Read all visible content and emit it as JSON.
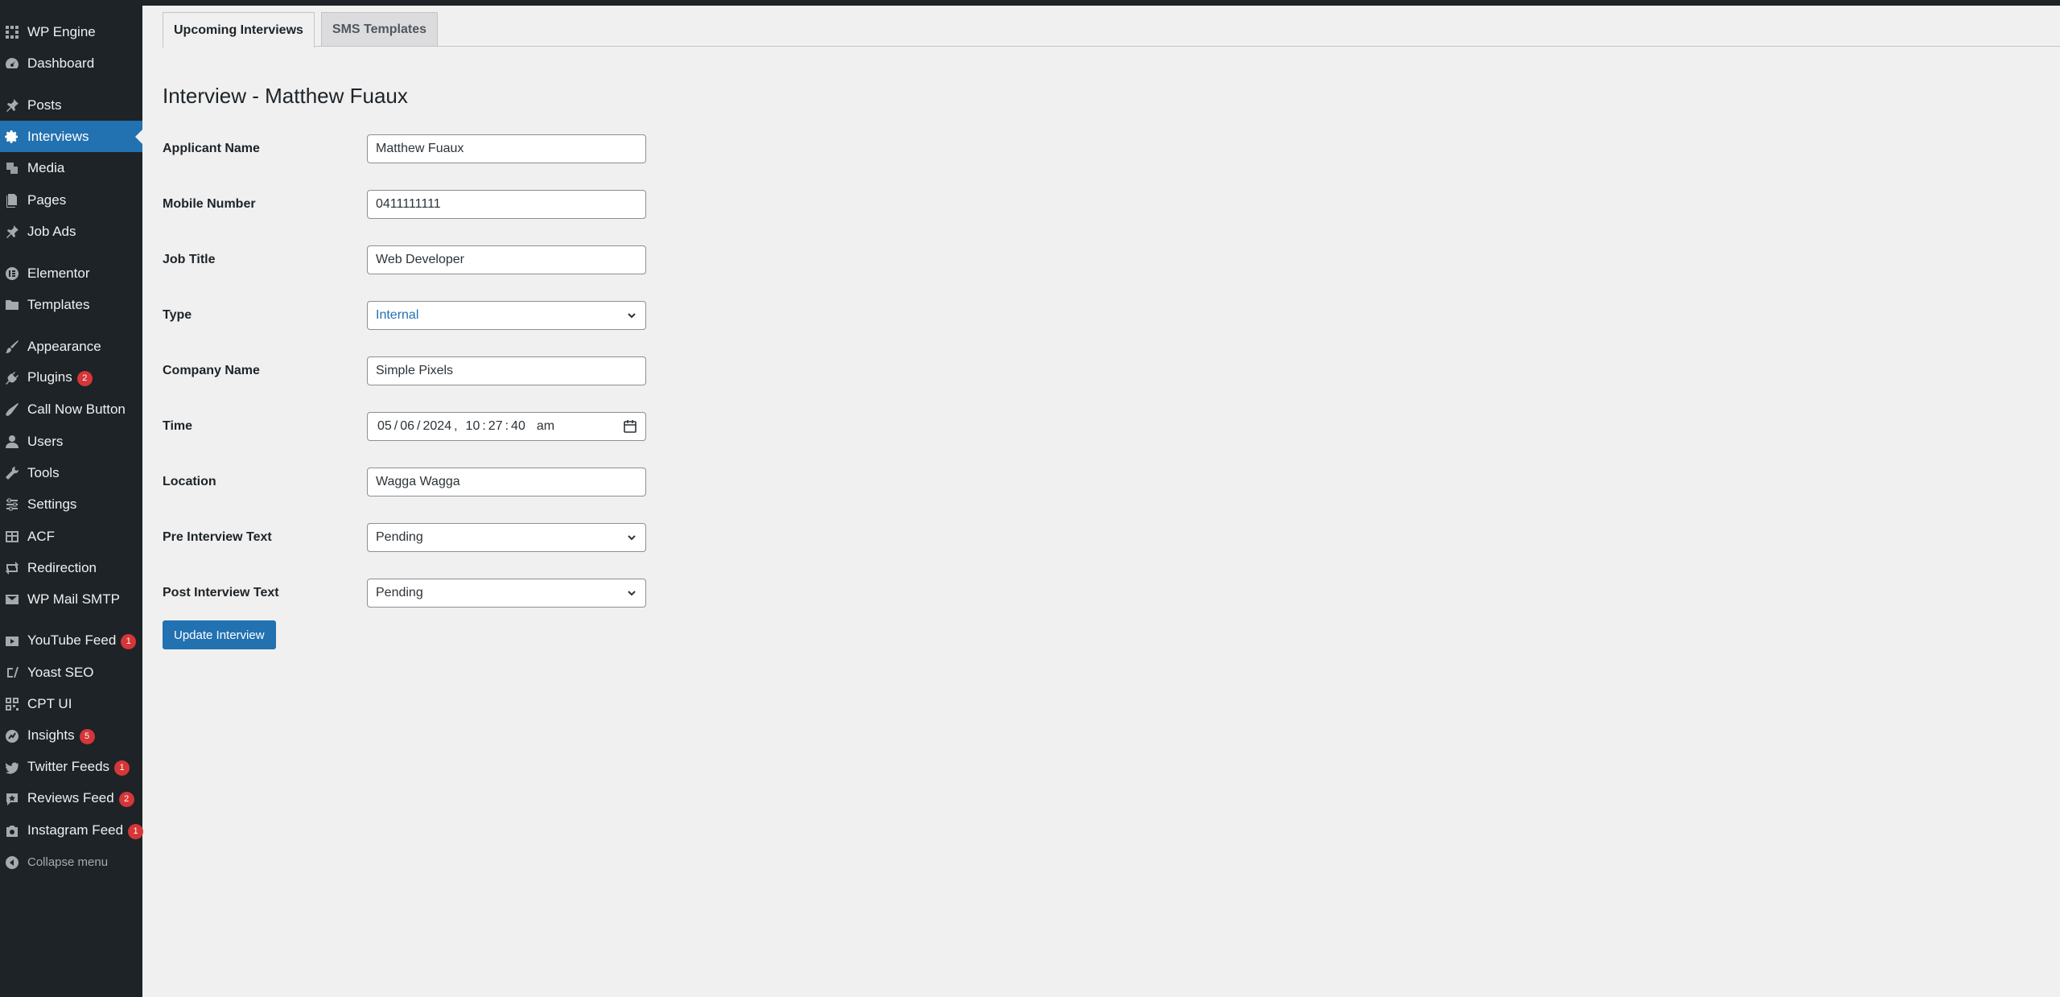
{
  "sidebar": {
    "items": [
      {
        "label": "WP Engine",
        "icon": "wp-engine-icon",
        "badge": null
      },
      {
        "label": "Dashboard",
        "icon": "dashboard-icon",
        "badge": null
      },
      {
        "label": "Posts",
        "icon": "pin-icon",
        "badge": null
      },
      {
        "label": "Interviews",
        "icon": "gear-icon",
        "badge": null
      },
      {
        "label": "Media",
        "icon": "media-icon",
        "badge": null
      },
      {
        "label": "Pages",
        "icon": "pages-icon",
        "badge": null
      },
      {
        "label": "Job Ads",
        "icon": "pin-icon",
        "badge": null
      },
      {
        "label": "Elementor",
        "icon": "elementor-icon",
        "badge": null
      },
      {
        "label": "Templates",
        "icon": "folder-icon",
        "badge": null
      },
      {
        "label": "Appearance",
        "icon": "brush-icon",
        "badge": null
      },
      {
        "label": "Plugins",
        "icon": "plugin-icon",
        "badge": "2"
      },
      {
        "label": "Call Now Button",
        "icon": "phone-icon",
        "badge": null
      },
      {
        "label": "Users",
        "icon": "user-icon",
        "badge": null
      },
      {
        "label": "Tools",
        "icon": "wrench-icon",
        "badge": null
      },
      {
        "label": "Settings",
        "icon": "settings-icon",
        "badge": null
      },
      {
        "label": "ACF",
        "icon": "acf-icon",
        "badge": null
      },
      {
        "label": "Redirection",
        "icon": "redirect-icon",
        "badge": null
      },
      {
        "label": "WP Mail SMTP",
        "icon": "mail-icon",
        "badge": null
      },
      {
        "label": "YouTube Feed",
        "icon": "youtube-icon",
        "badge": "1"
      },
      {
        "label": "Yoast SEO",
        "icon": "yoast-icon",
        "badge": null
      },
      {
        "label": "CPT UI",
        "icon": "cpt-icon",
        "badge": null
      },
      {
        "label": "Insights",
        "icon": "insights-icon",
        "badge": "5"
      },
      {
        "label": "Twitter Feeds",
        "icon": "twitter-icon",
        "badge": "1"
      },
      {
        "label": "Reviews Feed",
        "icon": "reviews-icon",
        "badge": "2"
      },
      {
        "label": "Instagram Feed",
        "icon": "instagram-icon",
        "badge": "1"
      }
    ],
    "collapse_label": "Collapse menu"
  },
  "tabs": [
    {
      "label": "Upcoming Interviews",
      "active": true
    },
    {
      "label": "SMS Templates",
      "active": false
    }
  ],
  "page_title": "Interview - Matthew Fuaux",
  "form": {
    "applicant_name": {
      "label": "Applicant Name",
      "value": "Matthew Fuaux"
    },
    "mobile_number": {
      "label": "Mobile Number",
      "value": "0411111111"
    },
    "job_title": {
      "label": "Job Title",
      "value": "Web Developer"
    },
    "type": {
      "label": "Type",
      "value": "Internal"
    },
    "company_name": {
      "label": "Company Name",
      "value": "Simple Pixels"
    },
    "time": {
      "label": "Time",
      "day": "05",
      "month": "06",
      "year": "2024",
      "hour": "10",
      "minute": "27",
      "second": "40",
      "ampm": "am"
    },
    "location": {
      "label": "Location",
      "value": "Wagga Wagga"
    },
    "pre_interview_text": {
      "label": "Pre Interview Text",
      "value": "Pending"
    },
    "post_interview_text": {
      "label": "Post Interview Text",
      "value": "Pending"
    }
  },
  "submit_label": "Update Interview",
  "colors": {
    "sidebar_bg": "#1d2327",
    "accent": "#2271b1",
    "badge": "#d63638",
    "page_bg": "#f0f0f1"
  }
}
